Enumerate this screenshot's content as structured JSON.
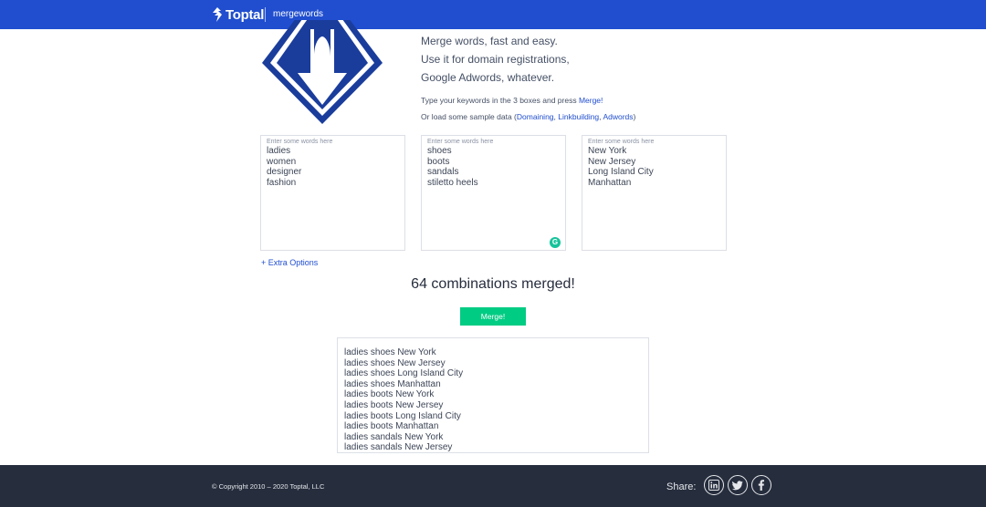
{
  "header": {
    "brand": "Toptal",
    "app_name": "mergewords"
  },
  "intro": {
    "line1": "Merge words, fast and easy.",
    "line2": "Use it for domain registrations,",
    "line3": "Google Adwords, whatever.",
    "instruction_prefix": "Type your keywords in the 3 boxes and press ",
    "instruction_link": "Merge!",
    "sample_prefix": "Or load some sample data (",
    "sample_links": [
      "Domaining",
      "Linkbuilding",
      "Adwords"
    ],
    "sample_suffix": ")"
  },
  "keyword_boxes": [
    {
      "placeholder": "Enter some words here",
      "value": "ladies\nwomen\ndesigner\nfashion"
    },
    {
      "placeholder": "Enter some words here",
      "value": "shoes\nboots\nsandals\nstiletto heels"
    },
    {
      "placeholder": "Enter some words here",
      "value": "New York\nNew Jersey\nLong Island City\nManhattan"
    }
  ],
  "extra_options": "+ Extra Options",
  "result_count": "64 combinations merged!",
  "merge_button": "Merge!",
  "output_lines": [
    "ladies shoes New York",
    "ladies shoes New Jersey",
    "ladies shoes Long Island City",
    "ladies shoes Manhattan",
    "ladies boots New York",
    "ladies boots New Jersey",
    "ladies boots Long Island City",
    "ladies boots Manhattan",
    "ladies sandals New York",
    "ladies sandals New Jersey"
  ],
  "footer": {
    "copyright": "© Copyright 2010 – 2020 Toptal, LLC",
    "share_label": "Share:",
    "social_icons": [
      "linkedin-icon",
      "twitter-icon",
      "facebook-icon"
    ]
  },
  "colors": {
    "header_bg": "#204ecf",
    "link": "#204ecf",
    "merge_button": "#00cc83",
    "footer_bg": "#262d3d"
  }
}
